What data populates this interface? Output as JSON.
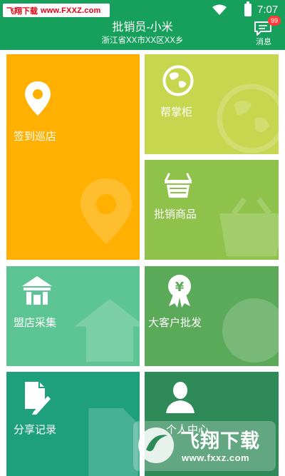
{
  "status_bar": {
    "watermark_site": "飞翔下载",
    "watermark_url": "www.FXXZ.com",
    "time": "7:07",
    "wifi_icon": "wifi-icon",
    "battery_icon": "battery-icon"
  },
  "header": {
    "title": "批销员-小米",
    "subtitle": "浙江省XX市XX区XX乡",
    "messages": {
      "label": "消息",
      "badge": "99",
      "icon": "message-icon"
    }
  },
  "tiles": {
    "checkin": {
      "label": "签到巡店",
      "icon": "location-pin-icon",
      "color": "#ffb000"
    },
    "cabinet": {
      "label": "帮掌柜",
      "icon": "globe-icon",
      "color": "#c6d64f"
    },
    "goods": {
      "label": "批销商品",
      "icon": "shopping-basket-icon",
      "color": "#8fc24a"
    },
    "store": {
      "label": "盟店采集",
      "icon": "house-icon",
      "color": "#5dc594"
    },
    "bigcustomer": {
      "label": "大客户批发",
      "icon": "yuan-medal-icon",
      "color": "#5aaa5a"
    },
    "share": {
      "label": "分享记录",
      "icon": "document-pen-icon",
      "color": "#1fa07d"
    },
    "user": {
      "label": "个人中心",
      "icon": "user-silhouette-icon",
      "color": "#2e8a57"
    }
  },
  "watermark_bottom": {
    "title": "飞翔下载",
    "url": "www.fxxz.com"
  }
}
